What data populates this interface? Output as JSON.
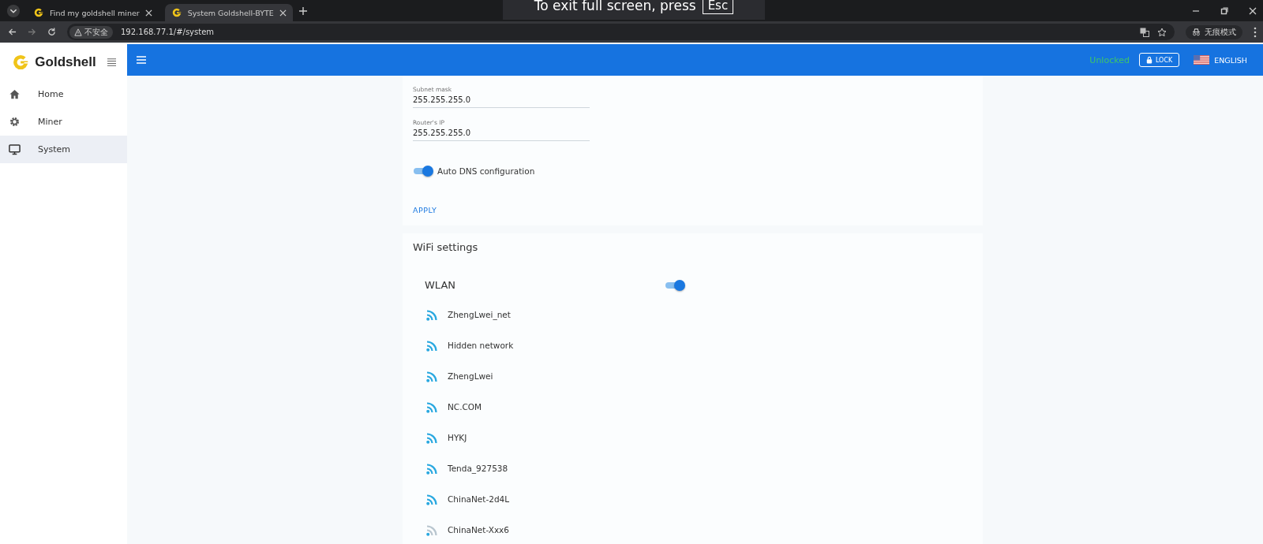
{
  "browser": {
    "tabs": [
      {
        "title": "Find my goldshell miner",
        "selected": false
      },
      {
        "title": "System Goldshell-BYTE",
        "selected": true
      }
    ],
    "address": "192.168.77.1/#/system",
    "security_label": "不安全",
    "profile_label": "无痕模式",
    "fullscreen_notice": {
      "text": "To exit full screen, press",
      "key": "Esc"
    }
  },
  "sidebar": {
    "brand": "Goldshell",
    "items": [
      {
        "label": "Home",
        "kind": "home",
        "selected": false
      },
      {
        "label": "Miner",
        "kind": "gear",
        "selected": false
      },
      {
        "label": "System",
        "kind": "monitor",
        "selected": true
      }
    ]
  },
  "header": {
    "status": "Unlocked",
    "lock_button": "LOCK",
    "language": "ENGLISH"
  },
  "network": {
    "fields": [
      {
        "label": "Subnet mask",
        "value": "255.255.255.0"
      },
      {
        "label": "Router's IP",
        "value": "255.255.255.0"
      }
    ],
    "auto_dns": {
      "label": "Auto DNS configuration",
      "on": true
    },
    "apply_button": "APPLY"
  },
  "wifi": {
    "title": "WiFi settings",
    "wlan": {
      "label": "WLAN",
      "on": true
    },
    "networks": [
      {
        "name": "ZhengLwei_net",
        "kind": "strong"
      },
      {
        "name": "Hidden network",
        "kind": "strong"
      },
      {
        "name": "ZhengLwei",
        "kind": "strong"
      },
      {
        "name": "NC.COM",
        "kind": "strong"
      },
      {
        "name": "HYKJ",
        "kind": "strong"
      },
      {
        "name": "Tenda_927538",
        "kind": "strong"
      },
      {
        "name": "ChinaNet-2d4L",
        "kind": "strong"
      },
      {
        "name": "ChinaNet-Xxx6",
        "kind": "weak"
      }
    ]
  }
}
